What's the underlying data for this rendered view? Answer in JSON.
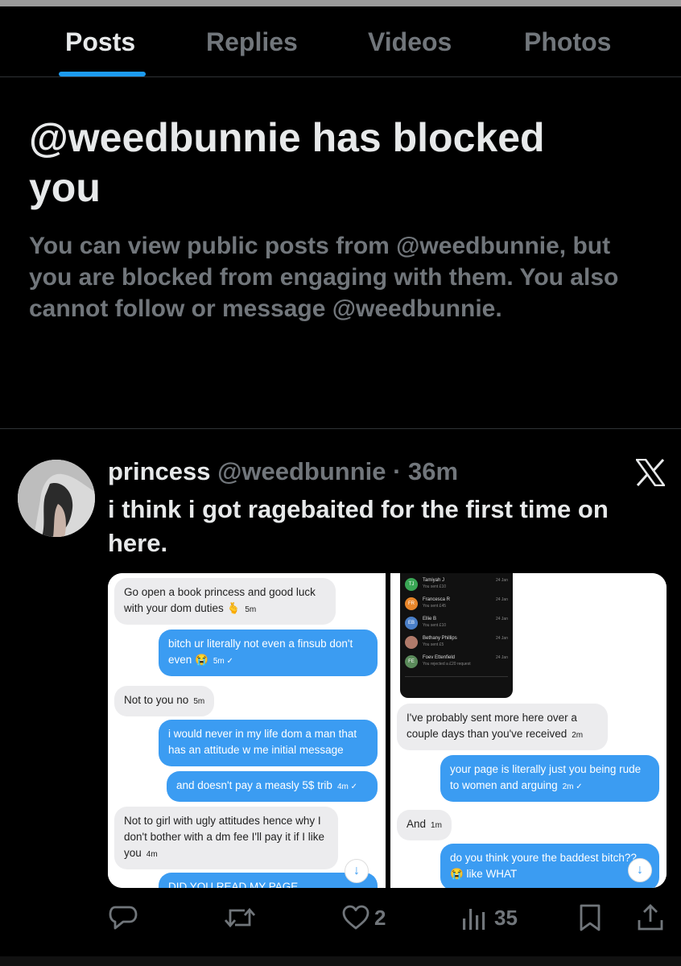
{
  "tabs": [
    {
      "label": "Posts",
      "active": true
    },
    {
      "label": "Replies",
      "active": false
    },
    {
      "label": "Videos",
      "active": false
    },
    {
      "label": "Photos",
      "active": false
    }
  ],
  "blocked": {
    "title": "@weedbunnie has blocked you",
    "body": "You can view public posts from @weedbunnie, but you are blocked from engaging with them. You also cannot follow or message @weedbunnie."
  },
  "tweet": {
    "display_name": "princess",
    "meta": "@weedbunnie · 36m",
    "text": "i think i got ragebaited for the first time on here.",
    "source_icon": "x-logo-icon",
    "actions": {
      "reply_icon": "reply-icon",
      "retweet_icon": "retweet-icon",
      "like_count": "2",
      "views_count": "35",
      "bookmark_icon": "bookmark-icon",
      "share_icon": "share-icon"
    }
  },
  "media": {
    "left_chat": [
      {
        "side": "gray",
        "text": "Go open a book princess and good luck with your dom duties 🫰",
        "time": "5m"
      },
      {
        "side": "blue",
        "text": "bitch ur literally not even a finsub don't even 😭",
        "time": "5m ✓"
      },
      {
        "side": "gray",
        "text": "Not to you no",
        "time": "5m"
      },
      {
        "side": "blue",
        "text": "i would never in my life dom a man that has an attitude w me initial message",
        "time": ""
      },
      {
        "side": "blue",
        "text": "and doesn't pay a measly 5$ trib",
        "time": "4m ✓"
      },
      {
        "side": "gray",
        "text": "Not to girl with ugly attitudes hence why I don't bother with a dm fee I'll pay it if I like you",
        "time": "4m"
      },
      {
        "side": "blue",
        "text": "DID YOU READ MY PAGE BROTHERRR",
        "time": ""
      }
    ],
    "phone_rows": [
      {
        "initials": "TJ",
        "name": "Tamiyah J",
        "sub": "You sent £10",
        "date": "24 Jan",
        "color": "#3aa655"
      },
      {
        "initials": "FR",
        "name": "Francesca R",
        "sub": "You sent £45",
        "date": "24 Jan",
        "color": "#e8862a"
      },
      {
        "initials": "EB",
        "name": "Ellie B",
        "sub": "You sent £10",
        "date": "24 Jan",
        "color": "#4a7fc8"
      },
      {
        "initials": "",
        "name": "Bethany Phillips",
        "sub": "You sent £5",
        "date": "24 Jan",
        "color": "#b07a6a"
      },
      {
        "initials": "FE",
        "name": "Foev Ettenfield",
        "sub": "You rejected a £20 request",
        "date": "24 Jan",
        "color": "#5a8a5a"
      }
    ],
    "right_chat": [
      {
        "side": "gray",
        "text": "I've probably sent more here over a couple days than you've received",
        "time": "2m"
      },
      {
        "side": "blue",
        "text": "your page is literally just you being rude to women and arguing",
        "time": "2m ✓"
      },
      {
        "side": "gray",
        "text": "And",
        "time": "1m"
      },
      {
        "side": "blue",
        "text": "do you think youre the baddest bitch?? 😭 like WHAT",
        "time": ""
      }
    ]
  }
}
